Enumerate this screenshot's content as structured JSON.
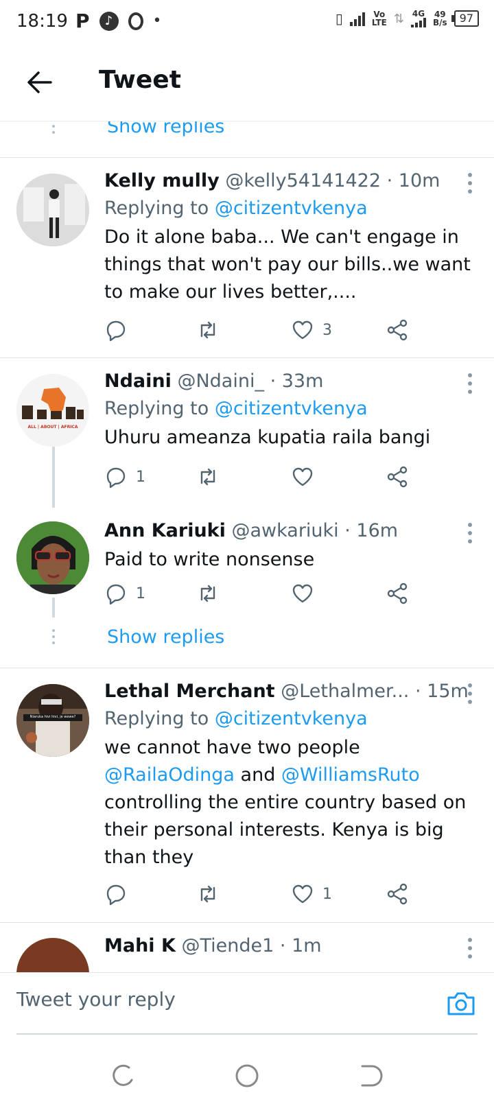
{
  "status_bar": {
    "time": "18:19",
    "app_p": "P",
    "vo_lte_top": "Vo",
    "vo_lte_bottom": "LTE",
    "net_type": "4G",
    "speed_value": "49",
    "speed_unit": "B/s",
    "battery": "97"
  },
  "header": {
    "title": "Tweet"
  },
  "show_replies_label": "Show replies",
  "tweets": [
    {
      "name": "Kelly mully",
      "handle": "@kelly54141422",
      "time": "· 10m",
      "replying_prefix": "Replying to",
      "replying_to": "@citizentvkenya",
      "text": "Do it alone baba... We can't engage in things that won't pay our bills..we want to make our lives better,....",
      "reply_count": "",
      "retweet_count": "",
      "like_count": "3"
    },
    {
      "name": "Ndaini",
      "handle": "@Ndaini_",
      "time": "· 33m",
      "replying_prefix": "Replying to",
      "replying_to": "@citizentvkenya",
      "text": "Uhuru ameanza kupatia raila bangi",
      "avatar_text": "ALL | ABOUT | AFRICA",
      "reply_count": "1",
      "retweet_count": "",
      "like_count": ""
    },
    {
      "name": "Ann Kariuki",
      "handle": "@awkariuki",
      "time": "· 16m",
      "text": "Paid to write nonsense",
      "reply_count": "1",
      "retweet_count": "",
      "like_count": ""
    },
    {
      "name": "Lethal Merchant",
      "handle": "@Lethalmer...",
      "time": "· 15m",
      "replying_prefix": "Replying to",
      "replying_to": "@citizentvkenya",
      "text_1": "we cannot have two people",
      "mention_1": "@RailaOdinga",
      "text_and": " and ",
      "mention_2": "@WilliamsRuto",
      "text_2": "controlling the entire country based on their personal interests. Kenya is big than they",
      "avatar_text": "Niaruka hivi hivi, je wewe?",
      "reply_count": "",
      "retweet_count": "",
      "like_count": "1"
    }
  ],
  "partial_tweet": {
    "name": "Mahi K",
    "handle": "@Tiende1",
    "time": "· 1m"
  },
  "reply_bar": {
    "placeholder": "Tweet your reply"
  },
  "colors": {
    "accent": "#1d9bf0",
    "text": "#0f1419",
    "muted": "#536471"
  }
}
